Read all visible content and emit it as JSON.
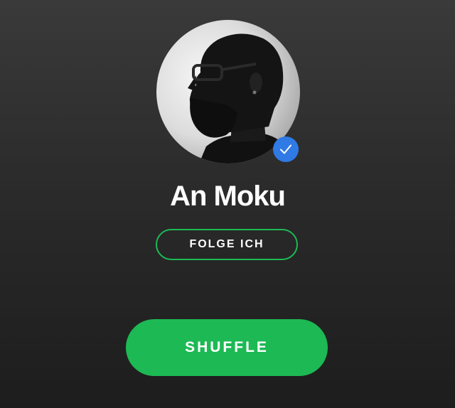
{
  "artist": {
    "name": "An Moku",
    "verified": true
  },
  "buttons": {
    "follow_label": "FOLGE ICH",
    "shuffle_label": "SHUFFLE"
  },
  "icons": {
    "verified": "checkmark-icon"
  },
  "colors": {
    "accent": "#1db954",
    "verified_badge": "#2f7ae5",
    "background_top": "#3a3a3a",
    "background_bottom": "#1d1d1d"
  }
}
